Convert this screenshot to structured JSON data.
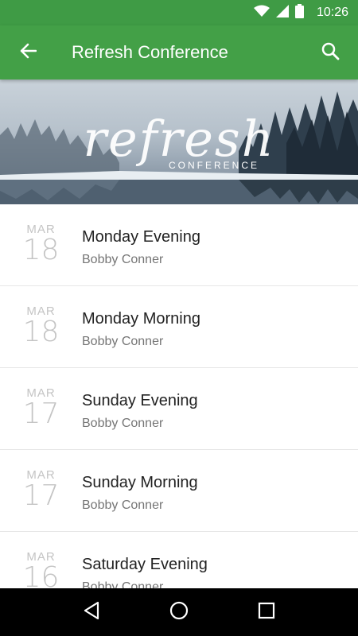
{
  "status_bar": {
    "time": "10:26",
    "icons": [
      "wifi-icon",
      "signal-icon",
      "battery-icon"
    ]
  },
  "app_bar": {
    "title": "Refresh Conference",
    "back_icon": "arrow-back-icon",
    "search_icon": "search-icon"
  },
  "banner": {
    "script": "refresh",
    "subtitle": "CONFERENCE"
  },
  "sessions": [
    {
      "month": "MAR",
      "day": "18",
      "title": "Monday Evening",
      "speaker": "Bobby Conner"
    },
    {
      "month": "MAR",
      "day": "18",
      "title": "Monday Morning",
      "speaker": "Bobby Conner"
    },
    {
      "month": "MAR",
      "day": "17",
      "title": "Sunday Evening",
      "speaker": "Bobby Conner"
    },
    {
      "month": "MAR",
      "day": "17",
      "title": "Sunday Morning",
      "speaker": "Bobby Conner"
    },
    {
      "month": "MAR",
      "day": "16",
      "title": "Saturday Evening",
      "speaker": "Bobby Conner"
    }
  ],
  "nav_bar": {
    "icons": [
      "back-triangle-icon",
      "home-circle-icon",
      "recents-square-icon"
    ]
  },
  "colors": {
    "app_bar": "#43a047",
    "status_bar": "#3f9b45",
    "date_text": "#c4c4c4",
    "speaker_text": "#757575"
  }
}
